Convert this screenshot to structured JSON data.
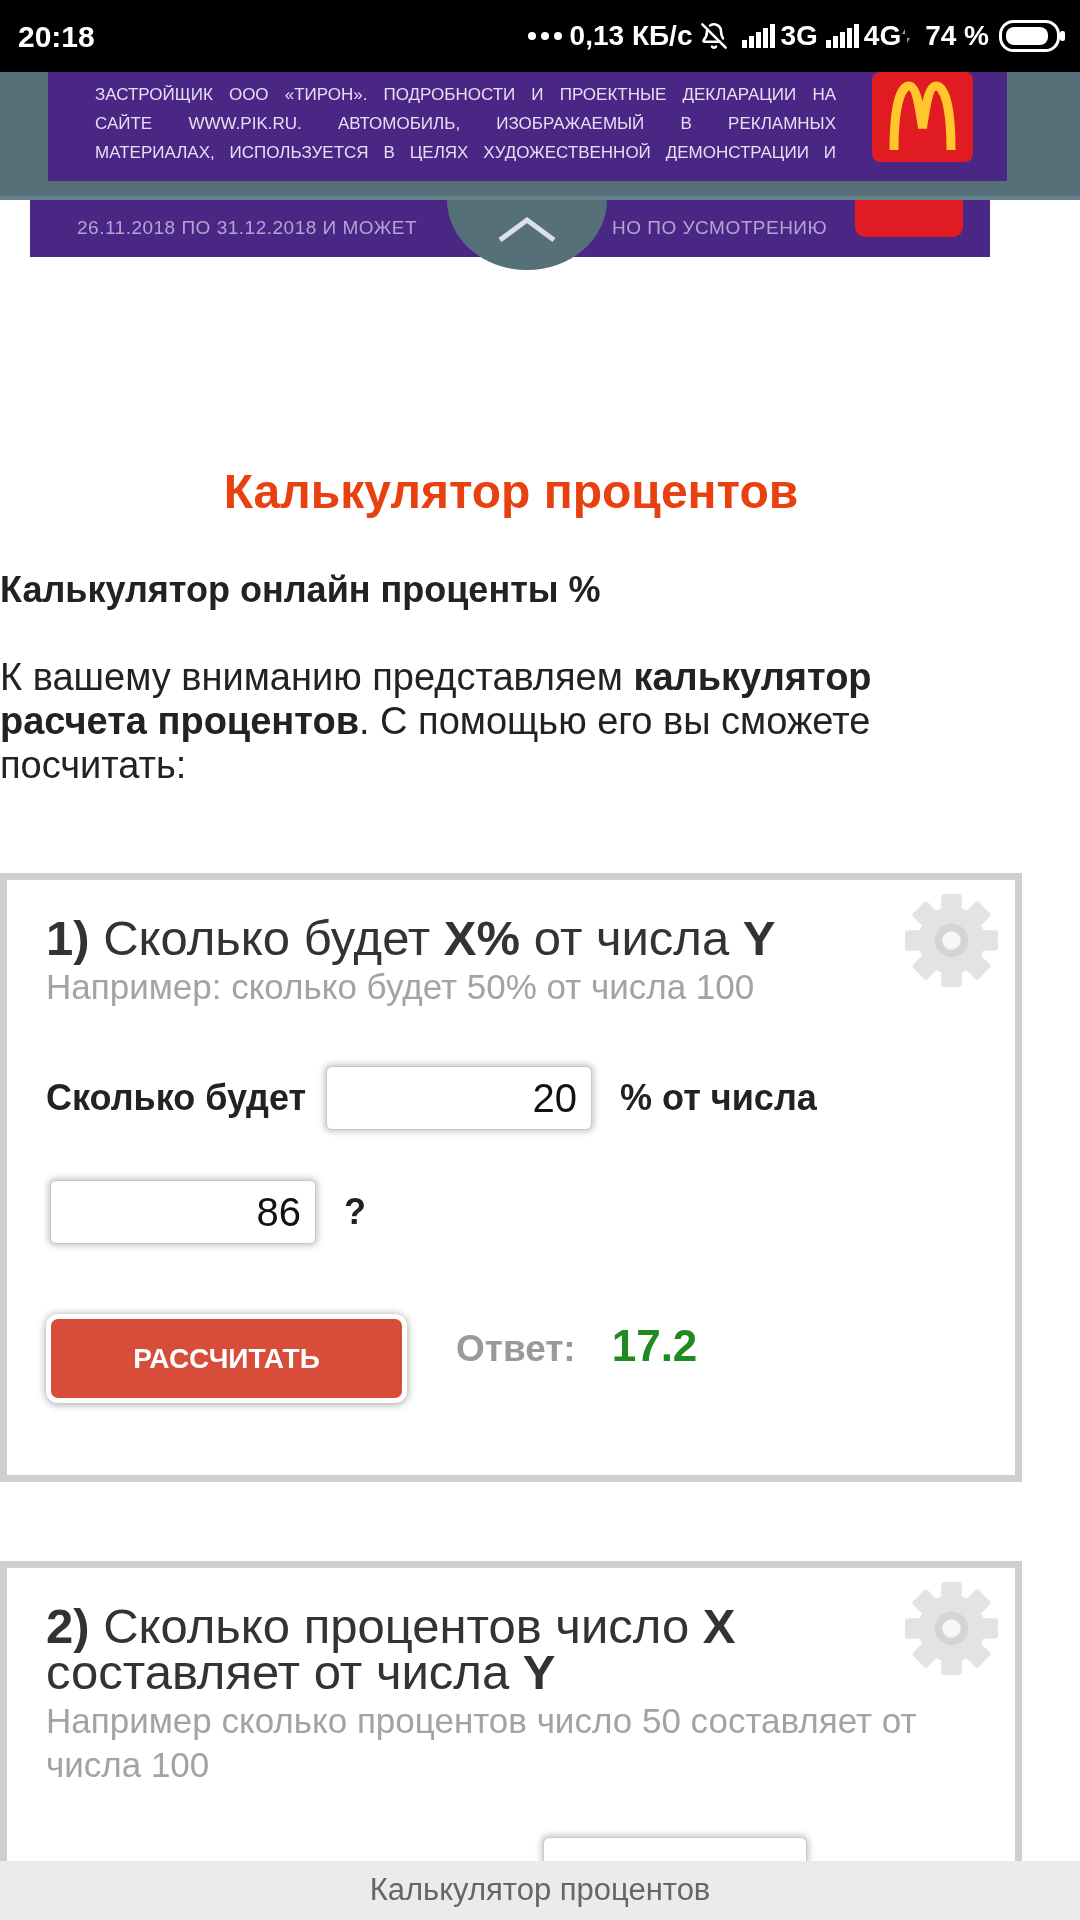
{
  "status_bar": {
    "time": "20:18",
    "speed": "0,13 КБ/с",
    "network_1": "3G",
    "network_2": "4G",
    "battery": "74 %"
  },
  "ad_overlay": {
    "disclaimer_lines": [
      "ЗАСТРОЙЩИК ООО «ТИРОН». ПОДРОБНОСТИ И ПРОЕКТНЫЕ ДЕКЛАРАЦИИ НА",
      "САЙТЕ WWW.PIK.RU. АВТОМОБИЛЬ, ИЗОБРАЖАЕМЫЙ В РЕКЛАМНЫХ",
      "МАТЕРИАЛАХ, ИСПОЛЬЗУЕТСЯ В ЦЕЛЯХ ХУДОЖЕСТВЕННОЙ ДЕМОНСТРАЦИИ И"
    ]
  },
  "ad_banner": {
    "text_left": "26.11.2018 ПО 31.12.2018 И МОЖЕТ",
    "text_right": "НО ПО УСМОТРЕНИЮ"
  },
  "article": {
    "title": "Калькулятор процентов",
    "heading": "Калькулятор онлайн проценты %",
    "intro": "К вашему вниманию представляем **калькулятор расчета процентов**. С помощью его вы сможете посчитать:"
  },
  "calculators": [
    {
      "title": "**1)** Сколько будет **X%** от числа **Y**",
      "example": "Например: сколько будет 50% от числа 100",
      "rows": [
        {
          "cut_off": false,
          "items": [
            {
              "kind": "label",
              "text": "Сколько будет"
            },
            {
              "kind": "input",
              "value": "20"
            },
            {
              "kind": "label",
              "text": "% от числа"
            }
          ]
        },
        {
          "cut_off": false,
          "items": [
            {
              "kind": "input",
              "value": "86"
            },
            {
              "kind": "label",
              "text": "?"
            }
          ]
        }
      ],
      "button": "РАССЧИТАТЬ",
      "answer_label": "Ответ:",
      "answer_value": "17.2"
    },
    {
      "title": "**2)** Сколько процентов число **X** составляет от числа **Y**",
      "example": "Например сколько процентов число 50 составляет от числа 100",
      "rows": [
        {
          "cut_off": true,
          "items": [
            {
              "kind": "input"
            }
          ]
        }
      ]
    }
  ],
  "bottom_bar": {
    "title": "Калькулятор процентов"
  }
}
